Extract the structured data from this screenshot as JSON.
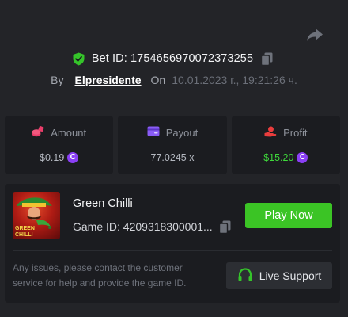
{
  "header": {
    "bet_id": "Bet ID: 1754656970072373255",
    "by_label": "By",
    "username": "Elpresidente",
    "on_label": "On",
    "date": "10.01.2023 г., 19:21:26 ч."
  },
  "stats": [
    {
      "label": "Amount",
      "value": "$0.19",
      "icon": "coins-icon",
      "coin": "C"
    },
    {
      "label": "Payout",
      "value": "77.0245 x",
      "icon": "wallet-icon"
    },
    {
      "label": "Profit",
      "value": "$15.20",
      "icon": "hand-coin-icon",
      "coin": "C"
    }
  ],
  "game": {
    "name": "Green Chilli",
    "game_id": "Game ID: 4209318300001...",
    "thumb_title": "GREEN CHILLI",
    "play_label": "Play Now"
  },
  "support": {
    "text": "Any issues, please contact the customer service for help and provide the game ID.",
    "button_label": "Live Support"
  },
  "colors": {
    "background": "#232428",
    "panel": "#1b1c20",
    "accent_green": "#3bc425",
    "profit_green": "#3fd93b",
    "coin_purple": "#8a3ff5",
    "amount_icon": "#ea3d6a",
    "payout_icon": "#8a5cf6",
    "profit_icon": "#ea3d3d"
  }
}
